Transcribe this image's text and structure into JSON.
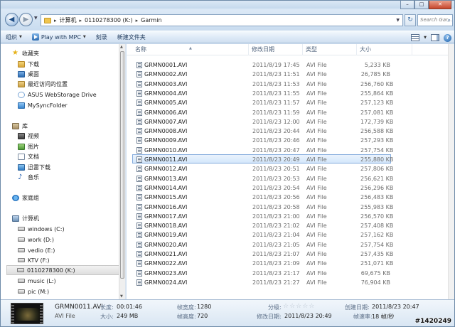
{
  "address": {
    "crumbs": [
      "计算机",
      "0110278300 (K:)",
      "Garmin"
    ],
    "search_placeholder": "Search Gar..."
  },
  "toolbar": {
    "organize": "组织",
    "play": "Play with MPC",
    "burn": "刻录",
    "new_folder": "新建文件夹"
  },
  "nav": {
    "favorites": "收藏夹",
    "downloads": "下载",
    "desktop": "桌面",
    "recent": "最近访问的位置",
    "asus": "ASUS WebStorage Drive",
    "sync": "MySyncFolder",
    "libraries": "库",
    "videos": "视频",
    "pictures": "图片",
    "documents": "文档",
    "thunder": "迅雷下载",
    "music": "音乐",
    "homegroup": "家庭组",
    "computer": "计算机",
    "drives": [
      "windows (C:)",
      "work (D:)",
      "vedio (E:)",
      "KTV (F:)",
      "0110278300 (K:)",
      "music (L:)",
      "pic (M:)"
    ]
  },
  "columns": {
    "name": "名称",
    "date": "修改日期",
    "type": "类型",
    "size": "大小"
  },
  "files": [
    {
      "name": "GRMN0001.AVI",
      "date": "2011/8/19 17:45",
      "type": "AVI File",
      "size": "5,233 KB"
    },
    {
      "name": "GRMN0002.AVI",
      "date": "2011/8/23 11:51",
      "type": "AVI File",
      "size": "26,785 KB"
    },
    {
      "name": "GRMN0003.AVI",
      "date": "2011/8/23 11:53",
      "type": "AVI File",
      "size": "256,760 KB"
    },
    {
      "name": "GRMN0004.AVI",
      "date": "2011/8/23 11:55",
      "type": "AVI File",
      "size": "255,864 KB"
    },
    {
      "name": "GRMN0005.AVI",
      "date": "2011/8/23 11:57",
      "type": "AVI File",
      "size": "257,123 KB"
    },
    {
      "name": "GRMN0006.AVI",
      "date": "2011/8/23 11:59",
      "type": "AVI File",
      "size": "257,081 KB"
    },
    {
      "name": "GRMN0007.AVI",
      "date": "2011/8/23 12:00",
      "type": "AVI File",
      "size": "172,739 KB"
    },
    {
      "name": "GRMN0008.AVI",
      "date": "2011/8/23 20:44",
      "type": "AVI File",
      "size": "256,588 KB"
    },
    {
      "name": "GRMN0009.AVI",
      "date": "2011/8/23 20:46",
      "type": "AVI File",
      "size": "257,293 KB"
    },
    {
      "name": "GRMN0010.AVI",
      "date": "2011/8/23 20:47",
      "type": "AVI File",
      "size": "257,754 KB"
    },
    {
      "name": "GRMN0011.AVI",
      "date": "2011/8/23 20:49",
      "type": "AVI File",
      "size": "255,880 KB"
    },
    {
      "name": "GRMN0012.AVI",
      "date": "2011/8/23 20:51",
      "type": "AVI File",
      "size": "257,806 KB"
    },
    {
      "name": "GRMN0013.AVI",
      "date": "2011/8/23 20:53",
      "type": "AVI File",
      "size": "256,621 KB"
    },
    {
      "name": "GRMN0014.AVI",
      "date": "2011/8/23 20:54",
      "type": "AVI File",
      "size": "256,296 KB"
    },
    {
      "name": "GRMN0015.AVI",
      "date": "2011/8/23 20:56",
      "type": "AVI File",
      "size": "256,483 KB"
    },
    {
      "name": "GRMN0016.AVI",
      "date": "2011/8/23 20:58",
      "type": "AVI File",
      "size": "255,983 KB"
    },
    {
      "name": "GRMN0017.AVI",
      "date": "2011/8/23 21:00",
      "type": "AVI File",
      "size": "256,570 KB"
    },
    {
      "name": "GRMN0018.AVI",
      "date": "2011/8/23 21:02",
      "type": "AVI File",
      "size": "257,408 KB"
    },
    {
      "name": "GRMN0019.AVI",
      "date": "2011/8/23 21:04",
      "type": "AVI File",
      "size": "257,162 KB"
    },
    {
      "name": "GRMN0020.AVI",
      "date": "2011/8/23 21:05",
      "type": "AVI File",
      "size": "257,754 KB"
    },
    {
      "name": "GRMN0021.AVI",
      "date": "2011/8/23 21:07",
      "type": "AVI File",
      "size": "257,435 KB"
    },
    {
      "name": "GRMN0022.AVI",
      "date": "2011/8/23 21:09",
      "type": "AVI File",
      "size": "251,071 KB"
    },
    {
      "name": "GRMN0023.AVI",
      "date": "2011/8/23 21:17",
      "type": "AVI File",
      "size": "69,675 KB"
    },
    {
      "name": "GRMN0024.AVI",
      "date": "2011/8/23 21:27",
      "type": "AVI File",
      "size": "76,904 KB"
    }
  ],
  "selected_index": 10,
  "details": {
    "name": "GRMN0011.AVI",
    "type": "AVI File",
    "length_label": "长度:",
    "length": "00:01:46",
    "size_label": "大小:",
    "size": "249 MB",
    "width_label": "帧宽度:",
    "width": "1280",
    "height_label": "帧高度:",
    "height": "720",
    "rating_label": "分级:",
    "modified_label": "修改日期:",
    "modified": "2011/8/23 20:49",
    "created_label": "创建日期:",
    "created": "2011/8/23 20:47",
    "framerate_label": "帧速率:",
    "framerate": "18 帧/秒"
  },
  "watermark": "#1420249"
}
